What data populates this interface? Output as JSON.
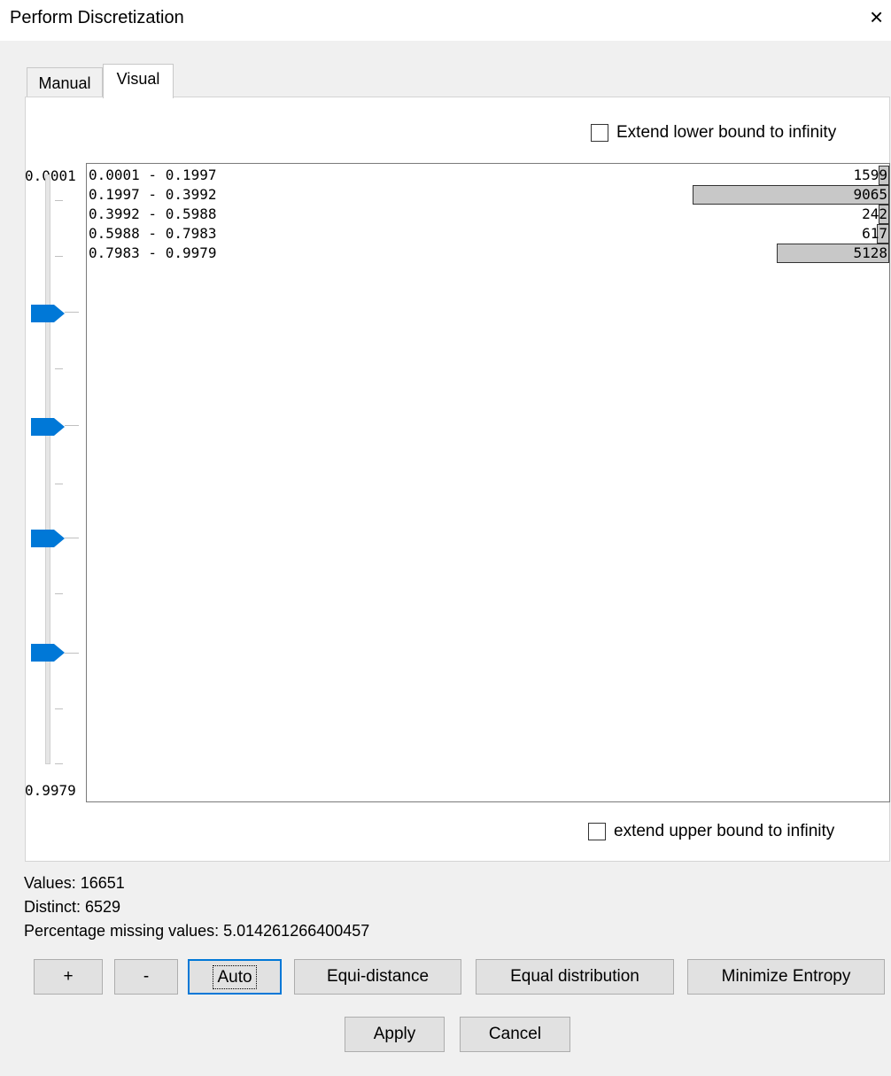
{
  "window": {
    "title": "Perform Discretization",
    "close_symbol": "×"
  },
  "tabs": [
    {
      "label": "Manual",
      "active": false
    },
    {
      "label": "Visual",
      "active": true
    }
  ],
  "visual": {
    "lower_bound_checkbox": {
      "label": "Extend lower bound to infinity",
      "checked": false
    },
    "upper_bound_checkbox": {
      "label": "extend upper bound to infinity",
      "checked": false
    },
    "slider": {
      "min_label": "0.0001",
      "max_label": "0.9979",
      "thumb_color": "#0078d7"
    },
    "bins": [
      {
        "range": "0.0001 - 0.1997",
        "count": "1599",
        "fraction": 0.0118
      },
      {
        "range": "0.1997 - 0.3992",
        "count": "9065",
        "fraction": 0.245
      },
      {
        "range": "0.3992 - 0.5988",
        "count": "242",
        "fraction": 0.0045
      },
      {
        "range": "0.5988 - 0.7983",
        "count": "617",
        "fraction": 0.0155
      },
      {
        "range": "0.7983 - 0.9979",
        "count": "5128",
        "fraction": 0.14
      }
    ]
  },
  "stats": {
    "values": "Values: 16651",
    "distinct": "Distinct: 6529",
    "missing": "Percentage missing values: 5.014261266400457"
  },
  "buttons": {
    "plus": "+",
    "minus": "-",
    "auto": "Auto",
    "equi_distance": "Equi-distance",
    "equal_distribution": "Equal distribution",
    "minimize_entropy": "Minimize Entropy",
    "apply": "Apply",
    "cancel": "Cancel"
  }
}
